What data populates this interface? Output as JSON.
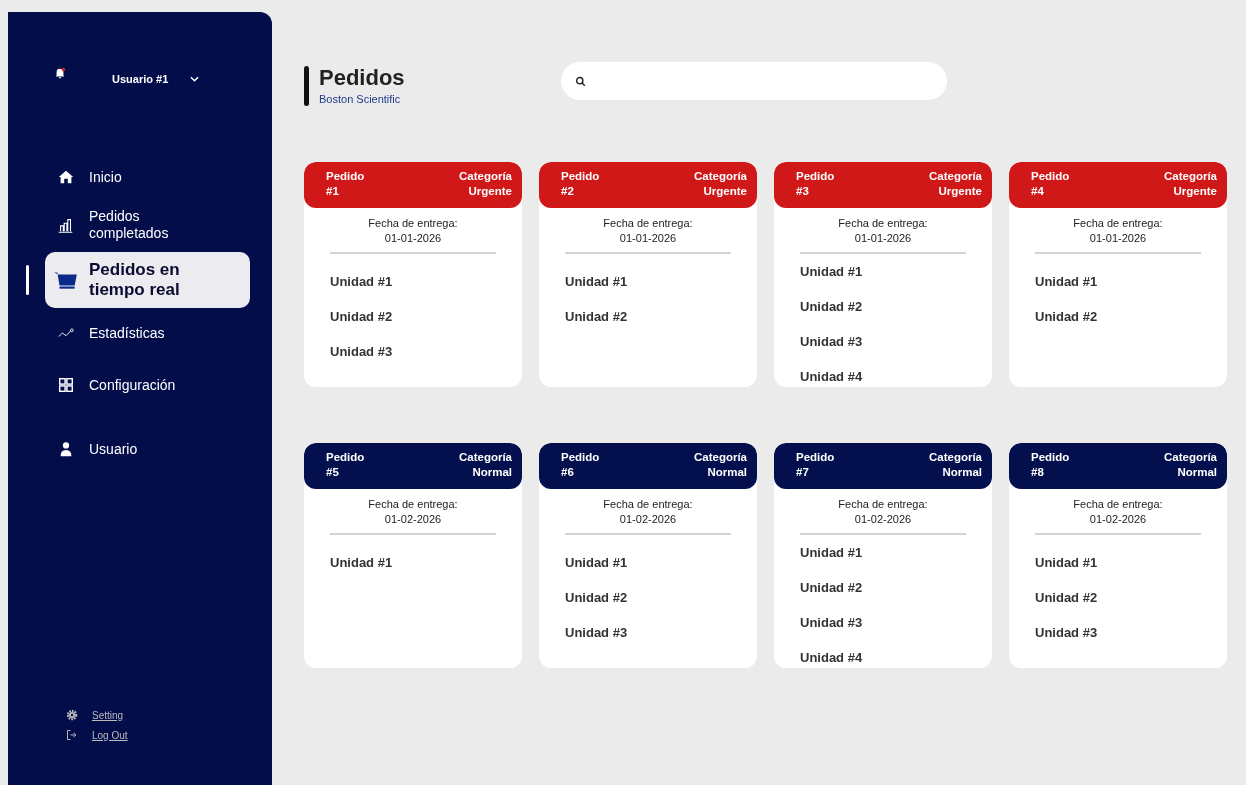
{
  "sidebar": {
    "notification": true,
    "user": "Usuario #1",
    "items": [
      {
        "label": "Inicio",
        "selected": false
      },
      {
        "label": "Pedidos completados",
        "selected": false
      },
      {
        "label": "Pedidos en tiempo real",
        "selected": true
      },
      {
        "label": "Estadísticas",
        "selected": false
      },
      {
        "label": "Configuración",
        "selected": false
      },
      {
        "label": "Usuario",
        "selected": false
      }
    ],
    "footer_links": [
      "Setting",
      "Log Out"
    ]
  },
  "header": {
    "title": "Pedidos",
    "subtitle": "Boston Scientific"
  },
  "orders": [
    {
      "order_label": "Pedido",
      "order_number": "#1",
      "category_label": "Categoría",
      "category": "Urgente",
      "color": "#d01818",
      "date_label": "Fecha de entrega:",
      "date": "01-01-2026",
      "units": [
        "Unidad #1",
        "Unidad #2",
        "Unidad #3"
      ]
    },
    {
      "order_label": "Pedido",
      "order_number": "#2",
      "category_label": "Categoría",
      "category": "Urgente",
      "color": "#d01818",
      "date_label": "Fecha de entrega:",
      "date": "01-01-2026",
      "units": [
        "Unidad #1",
        "Unidad #2"
      ]
    },
    {
      "order_label": "Pedido",
      "order_number": "#3",
      "category_label": "Categoría",
      "category": "Urgente",
      "color": "#d01818",
      "date_label": "Fecha de entrega:",
      "date": "01-01-2026",
      "units": [
        "Unidad #1",
        "Unidad #2",
        "Unidad #3",
        "Unidad #4"
      ]
    },
    {
      "order_label": "Pedido",
      "order_number": "#4",
      "category_label": "Categoría",
      "category": "Urgente",
      "color": "#d01818",
      "date_label": "Fecha de entrega:",
      "date": "01-01-2026",
      "units": [
        "Unidad #1",
        "Unidad #2"
      ]
    },
    {
      "order_label": "Pedido",
      "order_number": "#5",
      "category_label": "Categoría",
      "category": "Normal",
      "color": "#03104d",
      "date_label": "Fecha de entrega:",
      "date": "01-02-2026",
      "units": [
        "Unidad #1"
      ]
    },
    {
      "order_label": "Pedido",
      "order_number": "#6",
      "category_label": "Categoría",
      "category": "Normal",
      "color": "#03104d",
      "date_label": "Fecha de entrega:",
      "date": "01-02-2026",
      "units": [
        "Unidad #1",
        "Unidad #2",
        "Unidad #3"
      ]
    },
    {
      "order_label": "Pedido",
      "order_number": "#7",
      "category_label": "Categoría",
      "category": "Normal",
      "color": "#03104d",
      "date_label": "Fecha de entrega:",
      "date": "01-02-2026",
      "units": [
        "Unidad #1",
        "Unidad #2",
        "Unidad #3",
        "Unidad #4"
      ]
    },
    {
      "order_label": "Pedido",
      "order_number": "#8",
      "category_label": "Categoría",
      "category": "Normal",
      "color": "#03104d",
      "date_label": "Fecha de entrega:",
      "date": "01-02-2026",
      "units": [
        "Unidad #1",
        "Unidad #2",
        "Unidad #3"
      ]
    }
  ]
}
